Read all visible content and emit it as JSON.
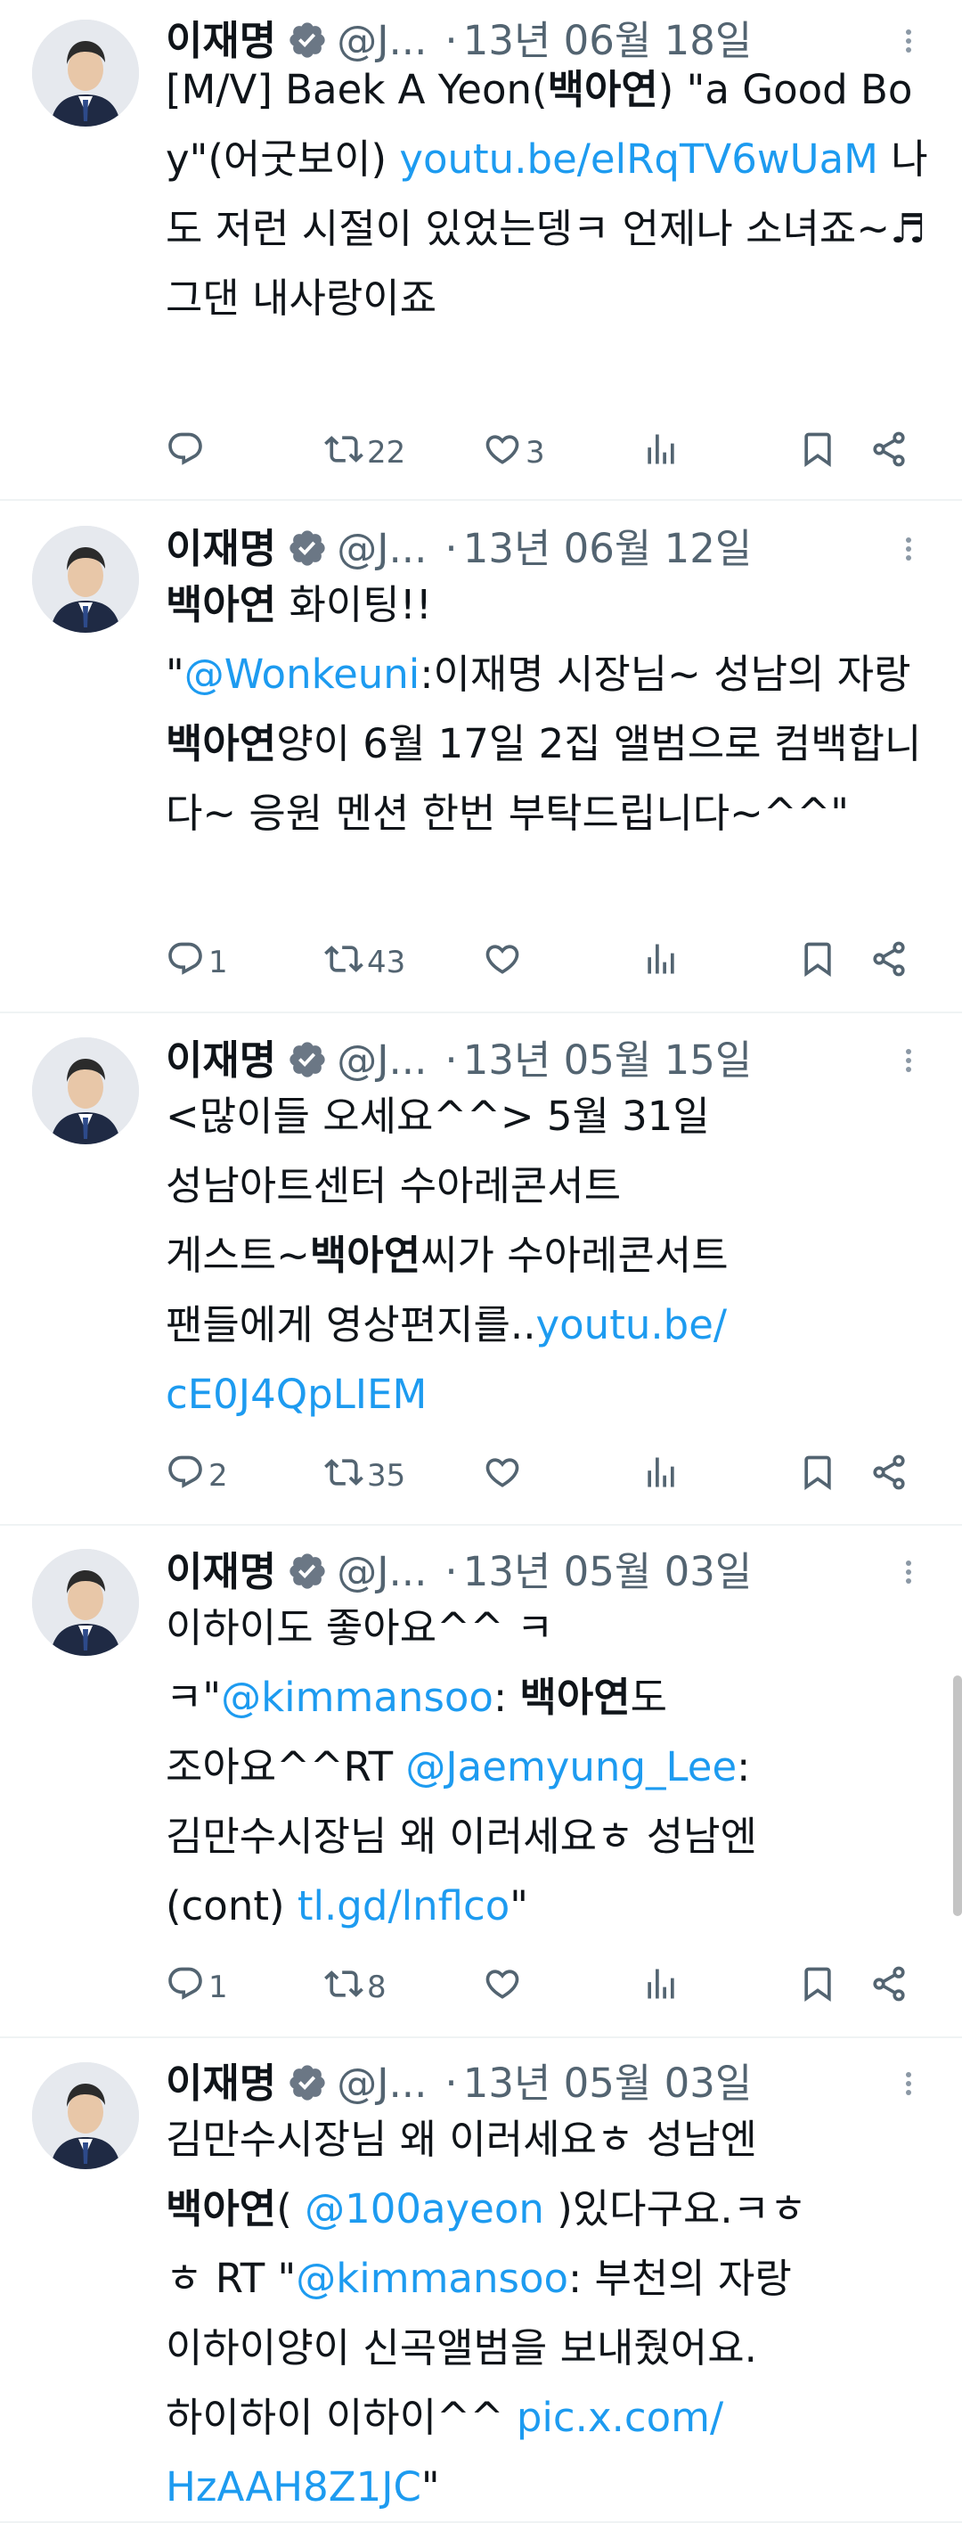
{
  "colors": {
    "link": "#1d9bf0",
    "muted": "#536471",
    "verified": "#6b7785",
    "text": "#0f1419"
  },
  "icons": {
    "verified": "verified-badge-icon",
    "more": "more-icon",
    "reply": "reply-icon",
    "retweet": "retweet-icon",
    "like": "heart-icon",
    "views": "views-icon",
    "bookmark": "bookmark-icon",
    "share": "share-icon"
  },
  "tweets": [
    {
      "name": "이재명",
      "handle": "@J...",
      "dot": "·",
      "date": "13년 06월 18일",
      "text": [
        {
          "t": "[M/V] Baek A Yeon("
        },
        {
          "t": "백아연",
          "b": true
        },
        {
          "t": ") \"a Good Boy\"(어굿보이) "
        },
        {
          "t": "youtu.be/elRqTV6wUaM",
          "l": true
        },
        {
          "t": " 나도 저런 시절이 있었는뎅ㅋ 언제나 소녀죠~♬ 그댄 내사랑이죠"
        }
      ],
      "replies": "",
      "retweets": "22",
      "likes": "3"
    },
    {
      "name": "이재명",
      "handle": "@J...",
      "dot": "·",
      "date": "13년 06월 12일",
      "text": [
        {
          "t": "백아연",
          "b": true
        },
        {
          "t": " 화이팅!!\n\""
        },
        {
          "t": "@Wonkeuni",
          "l": true
        },
        {
          "t": ":이재명 시장님~ 성남의 자랑 "
        },
        {
          "t": "백아연",
          "b": true
        },
        {
          "t": "양이 6월 17일 2집 앨범으로 컴백합니다~ 응원 멘션 한번 부탁드립니다~^^\""
        }
      ],
      "replies": "1",
      "retweets": "43",
      "likes": ""
    },
    {
      "name": "이재명",
      "handle": "@J...",
      "dot": "·",
      "date": "13년 05월 15일",
      "text": [
        {
          "t": "<많이들 오세요^^> 5월 31일\n성남아트센터 수아레콘서트\n게스트~"
        },
        {
          "t": "백아연",
          "b": true
        },
        {
          "t": "씨가 수아레콘서트\n팬들에게 영상편지를.."
        },
        {
          "t": "youtu.be/\ncE0J4QpLIEM",
          "l": true
        }
      ],
      "replies": "2",
      "retweets": "35",
      "likes": ""
    },
    {
      "name": "이재명",
      "handle": "@J...",
      "dot": "·",
      "date": "13년 05월 03일",
      "text": [
        {
          "t": "이하이도 좋아요^^ ㅋ\nㅋ\""
        },
        {
          "t": "@kimmansoo",
          "l": true
        },
        {
          "t": ": "
        },
        {
          "t": "백아연",
          "b": true
        },
        {
          "t": "도\n조아요^^RT "
        },
        {
          "t": "@Jaemyung_Lee",
          "l": true
        },
        {
          "t": ":\n김만수시장님 왜 이러세요ㅎ 성남엔\n(cont) "
        },
        {
          "t": "tl.gd/lnflco",
          "l": true
        },
        {
          "t": "\""
        }
      ],
      "replies": "1",
      "retweets": "8",
      "likes": ""
    },
    {
      "name": "이재명",
      "handle": "@J...",
      "dot": "·",
      "date": "13년 05월 03일",
      "text": [
        {
          "t": "김만수시장님 왜 이러세요ㅎ 성남엔\n"
        },
        {
          "t": "백아연",
          "b": true
        },
        {
          "t": "( "
        },
        {
          "t": "@100ayeon",
          "l": true
        },
        {
          "t": " )있다구요.ㅋㅎ\nㅎ RT \""
        },
        {
          "t": "@kimmansoo",
          "l": true
        },
        {
          "t": ": 부천의 자랑\n이하이양이 신곡앨범을 보내줬어요.\n하이하이 이하이^^ "
        },
        {
          "t": "pic.x.com/\nHzAAH8Z1JC",
          "l": true
        },
        {
          "t": "\""
        }
      ],
      "replies": "",
      "retweets": "",
      "likes": ""
    }
  ]
}
